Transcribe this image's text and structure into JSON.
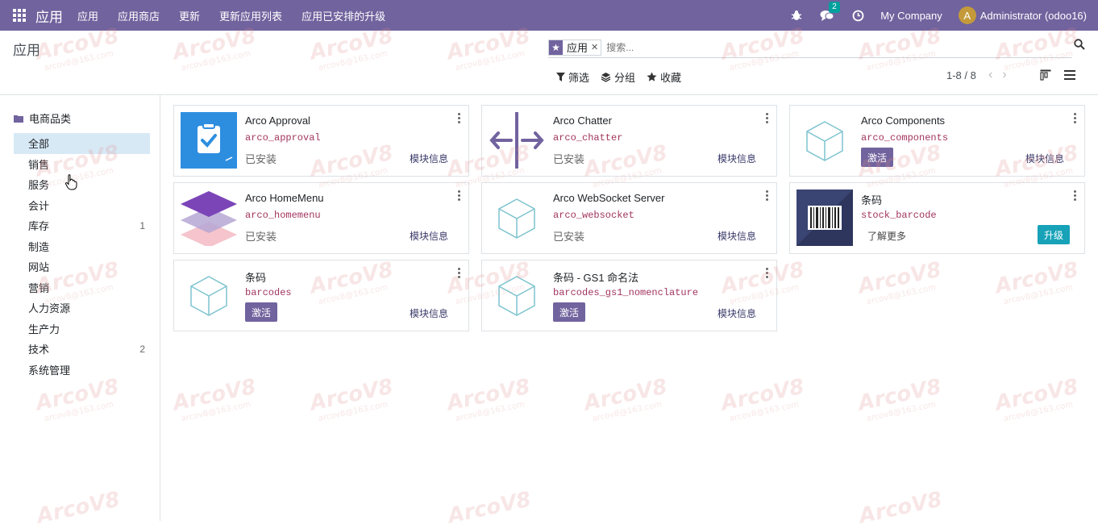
{
  "navbar": {
    "brand": "应用",
    "menu": [
      "应用",
      "应用商店",
      "更新",
      "更新应用列表",
      "应用已安排的升级"
    ],
    "messages_count": "2",
    "company": "My Company",
    "avatar_letter": "A",
    "user": "Administrator (odoo16)"
  },
  "control": {
    "title": "应用",
    "facet_value": "应用",
    "search_placeholder": "搜索...",
    "filters_label": "筛选",
    "group_label": "分组",
    "favorites_label": "收藏",
    "pager": "1-8 / 8"
  },
  "sidebar": {
    "header": "电商品类",
    "items": [
      {
        "label": "全部",
        "count": ""
      },
      {
        "label": "销售",
        "count": ""
      },
      {
        "label": "服务",
        "count": ""
      },
      {
        "label": "会计",
        "count": ""
      },
      {
        "label": "库存",
        "count": "1"
      },
      {
        "label": "制造",
        "count": ""
      },
      {
        "label": "网站",
        "count": ""
      },
      {
        "label": "营销",
        "count": ""
      },
      {
        "label": "人力资源",
        "count": ""
      },
      {
        "label": "生产力",
        "count": ""
      },
      {
        "label": "技术",
        "count": "2"
      },
      {
        "label": "系统管理",
        "count": ""
      }
    ]
  },
  "cards": [
    {
      "name": "Arco Approval",
      "tech": "arco_approval",
      "status": "已安装",
      "info": "模块信息",
      "icon": "approval-clipboard-icon"
    },
    {
      "name": "Arco Chatter",
      "tech": "arco_chatter",
      "status": "已安装",
      "info": "模块信息",
      "icon": "chatter-arrows-icon"
    },
    {
      "name": "Arco Components",
      "tech": "arco_components",
      "action": "激活",
      "info": "模块信息",
      "icon": "cube-icon"
    },
    {
      "name": "Arco HomeMenu",
      "tech": "arco_homemenu",
      "status": "已安装",
      "info": "模块信息",
      "icon": "layers-icon"
    },
    {
      "name": "Arco WebSocket Server",
      "tech": "arco_websocket",
      "status": "已安装",
      "info": "模块信息",
      "icon": "cube-icon"
    },
    {
      "name": "条码",
      "tech": "stock_barcode",
      "learn": "了解更多",
      "upgrade": "升级",
      "icon": "barcode-icon"
    },
    {
      "name": "条码",
      "tech": "barcodes",
      "action": "激活",
      "info": "模块信息",
      "icon": "cube-icon"
    },
    {
      "name": "条码 - GS1 命名法",
      "tech": "barcodes_gs1_nomenclature",
      "action": "激活",
      "info": "模块信息",
      "icon": "cube-icon"
    }
  ],
  "watermark": {
    "big": "ArcoV8",
    "small": "arcov8@163.com"
  },
  "colors": {
    "primary": "#71639e",
    "accent": "#17a2b8",
    "tech": "#a2345d",
    "active_category": "#d8e9f6"
  }
}
